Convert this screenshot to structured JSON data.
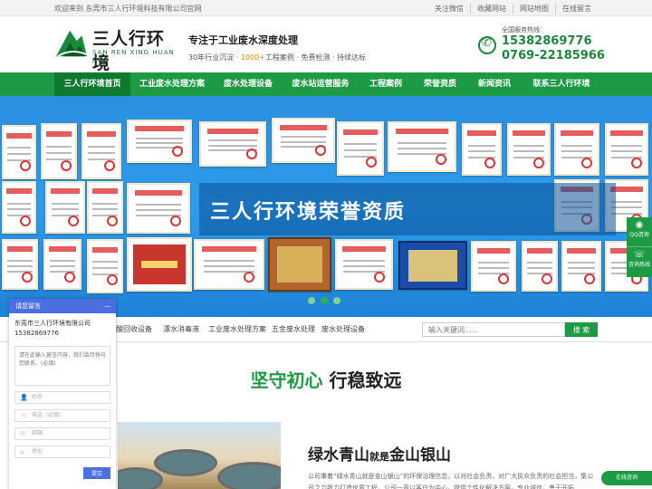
{
  "topbar": {
    "welcome": "欢迎来到 东莞市三人行环境科技有限公司官网",
    "links": [
      "关注微信",
      "收藏网站",
      "网站地图",
      "在线留言"
    ]
  },
  "logo": {
    "cn": "三人行环境",
    "en": "SAN REN XING HUAN JING"
  },
  "slogan": {
    "title": "专注于工业废水深度处理",
    "sub_a": "30年行业沉淀 · ",
    "sub_highlight": "1000+",
    "sub_b": "工程案例 · 免费检测 · 持续达标"
  },
  "hotline": {
    "label": "全国服务热线：",
    "phone1": "15382869776",
    "phone2": "0769-22185966"
  },
  "nav": {
    "items": [
      "三人行环境首页",
      "工业废水处理方案",
      "废水处理设备",
      "废水站运营服务",
      "工程案例",
      "荣誉资质",
      "新闻资讯",
      "联系三人行环境"
    ],
    "active_index": 0
  },
  "banner": {
    "headline": "三人行环境荣誉资质",
    "slide_count": 3,
    "active_slide": 1
  },
  "subnav": {
    "keywords": [
      "酸回收设备",
      "漂水消毒液",
      "工业废水处理方案",
      "五金废水处理",
      "废水处理设备"
    ],
    "search_placeholder": "输入关键词......",
    "search_button": "搜 索"
  },
  "section": {
    "title_green": "坚守初心",
    "title_dark": "行稳致远"
  },
  "about": {
    "title_a": "绿水青山",
    "title_mid": "就是",
    "title_b": "金山银山",
    "intro": "公司秉着“绿水青山就是金山银山”的环保治理信念，以对社会负责、对广大民众负责的社会担当，集公司之力致力打造优质工程，公司一直以客户为中心，提供个性化解决方案，专业诚信，勇于开拓..."
  },
  "chat": {
    "header": "请您留言",
    "minimize": "—",
    "company": "东莞市三人行环境有限公司15382869776",
    "message_placeholder": "请在此输入留言内容，我们会尽快与您联系。(必填)",
    "fields": [
      {
        "icon": "user-icon",
        "placeholder": "姓名"
      },
      {
        "icon": "phone-icon",
        "placeholder": "电话（必填）"
      },
      {
        "icon": "email-icon",
        "placeholder": "邮箱"
      },
      {
        "icon": "location-icon",
        "placeholder": "地址"
      }
    ],
    "submit": "提交"
  },
  "side_float": [
    {
      "icon": "qq-icon",
      "label": "QQ咨询"
    },
    {
      "icon": "phone-icon",
      "label": "咨询热线"
    }
  ],
  "online_consult": "在线咨询",
  "colors": {
    "brand_green": "#1d9a44",
    "nav_active": "#0d7a30",
    "chat_blue": "#4a6fe0",
    "banner_blue": "#2a8fe0"
  }
}
